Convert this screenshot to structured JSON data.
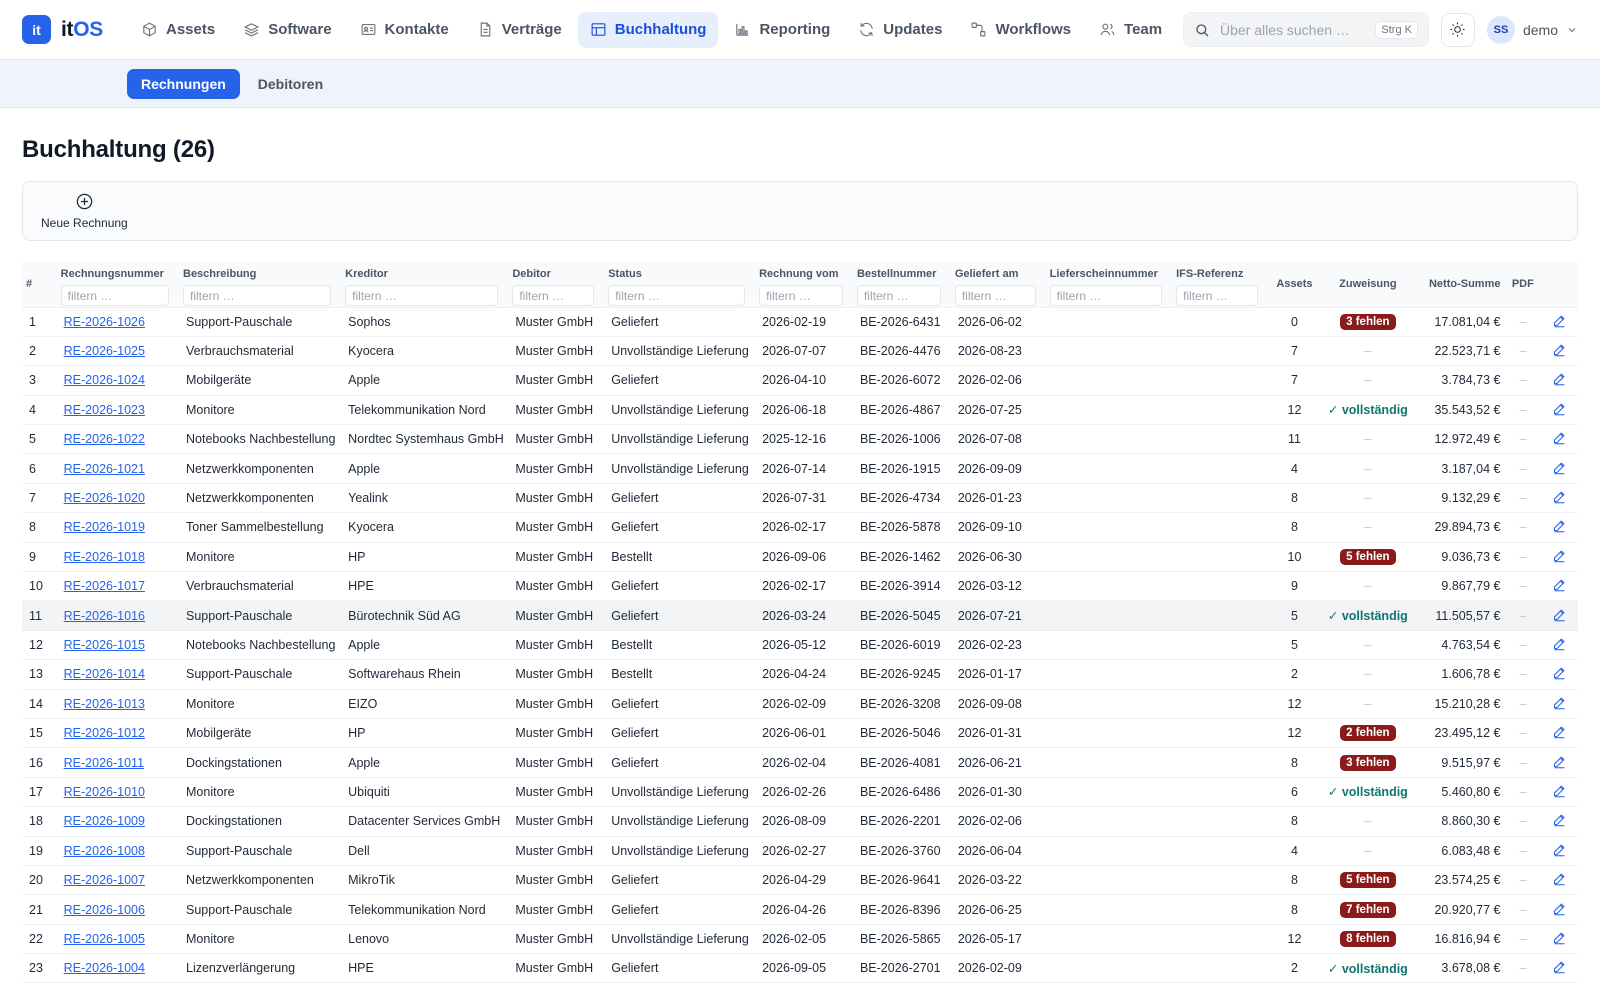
{
  "app": {
    "logo_mark": "it",
    "logo_prefix": "it",
    "logo_suffix": "OS"
  },
  "nav": [
    {
      "label": "Assets",
      "icon": "cube-icon",
      "active": false
    },
    {
      "label": "Software",
      "icon": "layers-icon",
      "active": false
    },
    {
      "label": "Kontakte",
      "icon": "contact-card-icon",
      "active": false
    },
    {
      "label": "Verträge",
      "icon": "document-icon",
      "active": false
    },
    {
      "label": "Buchhaltung",
      "icon": "table-icon",
      "active": true
    },
    {
      "label": "Reporting",
      "icon": "bar-chart-icon",
      "active": false
    },
    {
      "label": "Updates",
      "icon": "refresh-icon",
      "active": false
    },
    {
      "label": "Workflows",
      "icon": "workflow-icon",
      "active": false
    },
    {
      "label": "Team",
      "icon": "users-icon",
      "active": false
    }
  ],
  "search": {
    "placeholder": "Über alles suchen …",
    "shortcut": "Strg K"
  },
  "user": {
    "initials": "SS",
    "name": "demo"
  },
  "subtabs": [
    {
      "label": "Rechnungen",
      "active": true
    },
    {
      "label": "Debitoren",
      "active": false
    }
  ],
  "page": {
    "title": "Buchhaltung (26)"
  },
  "toolbar": {
    "new_invoice": "Neue Rechnung"
  },
  "filter_placeholder": "filtern …",
  "columns": {
    "num": "#",
    "invoice": "Rechnungsnummer",
    "desc": "Beschreibung",
    "creditor": "Kreditor",
    "debtor": "Debitor",
    "status": "Status",
    "invoice_date": "Rechnung vom",
    "order_no": "Bestellnummer",
    "delivered": "Geliefert am",
    "delivery_note": "Lieferscheinnummer",
    "ifs": "IFS-Referenz",
    "assets": "Assets",
    "assignment": "Zuweisung",
    "net": "Netto-Summe",
    "pdf": "PDF"
  },
  "rows": [
    {
      "n": "1",
      "invoice": "RE-2026-1026",
      "desc": "Support-Pauschale",
      "creditor": "Sophos",
      "debtor": "Muster GmbH",
      "status": "Geliefert",
      "date": "2026-02-19",
      "order": "BE-2026-6431",
      "delivered": "2026-06-02",
      "assets": "0",
      "assignment": "3 fehlen",
      "assign_type": "error",
      "net": "17.081,04 €",
      "pdf": "–"
    },
    {
      "n": "2",
      "invoice": "RE-2026-1025",
      "desc": "Verbrauchsmaterial",
      "creditor": "Kyocera",
      "debtor": "Muster GmbH",
      "status": "Unvollständige Lieferung",
      "date": "2026-07-07",
      "order": "BE-2026-4476",
      "delivered": "2026-08-23",
      "assets": "7",
      "assignment": "–",
      "assign_type": "none",
      "net": "22.523,71 €",
      "pdf": "–"
    },
    {
      "n": "3",
      "invoice": "RE-2026-1024",
      "desc": "Mobilgeräte",
      "creditor": "Apple",
      "debtor": "Muster GmbH",
      "status": "Geliefert",
      "date": "2026-04-10",
      "order": "BE-2026-6072",
      "delivered": "2026-02-06",
      "assets": "7",
      "assignment": "–",
      "assign_type": "none",
      "net": "3.784,73 €",
      "pdf": "–"
    },
    {
      "n": "4",
      "invoice": "RE-2026-1023",
      "desc": "Monitore",
      "creditor": "Telekommunikation Nord",
      "debtor": "Muster GmbH",
      "status": "Unvollständige Lieferung",
      "date": "2026-06-18",
      "order": "BE-2026-4867",
      "delivered": "2026-07-25",
      "assets": "12",
      "assignment": "✓ vollständig",
      "assign_type": "ok",
      "net": "35.543,52 €",
      "pdf": "–"
    },
    {
      "n": "5",
      "invoice": "RE-2026-1022",
      "desc": "Notebooks Nachbestellung",
      "creditor": "Nordtec Systemhaus GmbH",
      "debtor": "Muster GmbH",
      "status": "Unvollständige Lieferung",
      "date": "2025-12-16",
      "order": "BE-2026-1006",
      "delivered": "2026-07-08",
      "assets": "11",
      "assignment": "–",
      "assign_type": "none",
      "net": "12.972,49 €",
      "pdf": "–"
    },
    {
      "n": "6",
      "invoice": "RE-2026-1021",
      "desc": "Netzwerkkomponenten",
      "creditor": "Apple",
      "debtor": "Muster GmbH",
      "status": "Unvollständige Lieferung",
      "date": "2026-07-14",
      "order": "BE-2026-1915",
      "delivered": "2026-09-09",
      "assets": "4",
      "assignment": "–",
      "assign_type": "none",
      "net": "3.187,04 €",
      "pdf": "–"
    },
    {
      "n": "7",
      "invoice": "RE-2026-1020",
      "desc": "Netzwerkkomponenten",
      "creditor": "Yealink",
      "debtor": "Muster GmbH",
      "status": "Geliefert",
      "date": "2026-07-31",
      "order": "BE-2026-4734",
      "delivered": "2026-01-23",
      "assets": "8",
      "assignment": "–",
      "assign_type": "none",
      "net": "9.132,29 €",
      "pdf": "–"
    },
    {
      "n": "8",
      "invoice": "RE-2026-1019",
      "desc": "Toner Sammelbestellung",
      "creditor": "Kyocera",
      "debtor": "Muster GmbH",
      "status": "Geliefert",
      "date": "2026-02-17",
      "order": "BE-2026-5878",
      "delivered": "2026-09-10",
      "assets": "8",
      "assignment": "–",
      "assign_type": "none",
      "net": "29.894,73 €",
      "pdf": "–"
    },
    {
      "n": "9",
      "invoice": "RE-2026-1018",
      "desc": "Monitore",
      "creditor": "HP",
      "debtor": "Muster GmbH",
      "status": "Bestellt",
      "date": "2026-09-06",
      "order": "BE-2026-1462",
      "delivered": "2026-06-30",
      "assets": "10",
      "assignment": "5 fehlen",
      "assign_type": "error",
      "net": "9.036,73 €",
      "pdf": "–"
    },
    {
      "n": "10",
      "invoice": "RE-2026-1017",
      "desc": "Verbrauchsmaterial",
      "creditor": "HPE",
      "debtor": "Muster GmbH",
      "status": "Geliefert",
      "date": "2026-02-17",
      "order": "BE-2026-3914",
      "delivered": "2026-03-12",
      "assets": "9",
      "assignment": "–",
      "assign_type": "none",
      "net": "9.867,79 €",
      "pdf": "–"
    },
    {
      "n": "11",
      "invoice": "RE-2026-1016",
      "desc": "Support-Pauschale",
      "creditor": "Bürotechnik Süd AG",
      "debtor": "Muster GmbH",
      "status": "Geliefert",
      "date": "2026-03-24",
      "order": "BE-2026-5045",
      "delivered": "2026-07-21",
      "assets": "5",
      "assignment": "✓ vollständig",
      "assign_type": "ok",
      "net": "11.505,57 €",
      "pdf": "–"
    },
    {
      "n": "12",
      "invoice": "RE-2026-1015",
      "desc": "Notebooks Nachbestellung",
      "creditor": "Apple",
      "debtor": "Muster GmbH",
      "status": "Bestellt",
      "date": "2026-05-12",
      "order": "BE-2026-6019",
      "delivered": "2026-02-23",
      "assets": "5",
      "assignment": "–",
      "assign_type": "none",
      "net": "4.763,54 €",
      "pdf": "–"
    },
    {
      "n": "13",
      "invoice": "RE-2026-1014",
      "desc": "Support-Pauschale",
      "creditor": "Softwarehaus Rhein",
      "debtor": "Muster GmbH",
      "status": "Bestellt",
      "date": "2026-04-24",
      "order": "BE-2026-9245",
      "delivered": "2026-01-17",
      "assets": "2",
      "assignment": "–",
      "assign_type": "none",
      "net": "1.606,78 €",
      "pdf": "–"
    },
    {
      "n": "14",
      "invoice": "RE-2026-1013",
      "desc": "Monitore",
      "creditor": "EIZO",
      "debtor": "Muster GmbH",
      "status": "Geliefert",
      "date": "2026-02-09",
      "order": "BE-2026-3208",
      "delivered": "2026-09-08",
      "assets": "12",
      "assignment": "–",
      "assign_type": "none",
      "net": "15.210,28 €",
      "pdf": "–"
    },
    {
      "n": "15",
      "invoice": "RE-2026-1012",
      "desc": "Mobilgeräte",
      "creditor": "HP",
      "debtor": "Muster GmbH",
      "status": "Geliefert",
      "date": "2026-06-01",
      "order": "BE-2026-5046",
      "delivered": "2026-01-31",
      "assets": "12",
      "assignment": "2 fehlen",
      "assign_type": "error",
      "net": "23.495,12 €",
      "pdf": "–"
    },
    {
      "n": "16",
      "invoice": "RE-2026-1011",
      "desc": "Dockingstationen",
      "creditor": "Apple",
      "debtor": "Muster GmbH",
      "status": "Geliefert",
      "date": "2026-02-04",
      "order": "BE-2026-4081",
      "delivered": "2026-06-21",
      "assets": "8",
      "assignment": "3 fehlen",
      "assign_type": "error",
      "net": "9.515,97 €",
      "pdf": "–"
    },
    {
      "n": "17",
      "invoice": "RE-2026-1010",
      "desc": "Monitore",
      "creditor": "Ubiquiti",
      "debtor": "Muster GmbH",
      "status": "Unvollständige Lieferung",
      "date": "2026-02-26",
      "order": "BE-2026-6486",
      "delivered": "2026-01-30",
      "assets": "6",
      "assignment": "✓ vollständig",
      "assign_type": "ok",
      "net": "5.460,80 €",
      "pdf": "–"
    },
    {
      "n": "18",
      "invoice": "RE-2026-1009",
      "desc": "Dockingstationen",
      "creditor": "Datacenter Services GmbH",
      "debtor": "Muster GmbH",
      "status": "Unvollständige Lieferung",
      "date": "2026-08-09",
      "order": "BE-2026-2201",
      "delivered": "2026-02-06",
      "assets": "8",
      "assignment": "–",
      "assign_type": "none",
      "net": "8.860,30 €",
      "pdf": "–"
    },
    {
      "n": "19",
      "invoice": "RE-2026-1008",
      "desc": "Support-Pauschale",
      "creditor": "Dell",
      "debtor": "Muster GmbH",
      "status": "Unvollständige Lieferung",
      "date": "2026-02-27",
      "order": "BE-2026-3760",
      "delivered": "2026-06-04",
      "assets": "4",
      "assignment": "–",
      "assign_type": "none",
      "net": "6.083,48 €",
      "pdf": "–"
    },
    {
      "n": "20",
      "invoice": "RE-2026-1007",
      "desc": "Netzwerkkomponenten",
      "creditor": "MikroTik",
      "debtor": "Muster GmbH",
      "status": "Geliefert",
      "date": "2026-04-29",
      "order": "BE-2026-9641",
      "delivered": "2026-03-22",
      "assets": "8",
      "assignment": "5 fehlen",
      "assign_type": "error",
      "net": "23.574,25 €",
      "pdf": "–"
    },
    {
      "n": "21",
      "invoice": "RE-2026-1006",
      "desc": "Support-Pauschale",
      "creditor": "Telekommunikation Nord",
      "debtor": "Muster GmbH",
      "status": "Geliefert",
      "date": "2026-04-26",
      "order": "BE-2026-8396",
      "delivered": "2026-06-25",
      "assets": "8",
      "assignment": "7 fehlen",
      "assign_type": "error",
      "net": "20.920,77 €",
      "pdf": "–"
    },
    {
      "n": "22",
      "invoice": "RE-2026-1005",
      "desc": "Monitore",
      "creditor": "Lenovo",
      "debtor": "Muster GmbH",
      "status": "Unvollständige Lieferung",
      "date": "2026-02-05",
      "order": "BE-2026-5865",
      "delivered": "2026-05-17",
      "assets": "12",
      "assignment": "8 fehlen",
      "assign_type": "error",
      "net": "16.816,94 €",
      "pdf": "–"
    },
    {
      "n": "23",
      "invoice": "RE-2026-1004",
      "desc": "Lizenzverlängerung",
      "creditor": "HPE",
      "debtor": "Muster GmbH",
      "status": "Geliefert",
      "date": "2026-09-05",
      "order": "BE-2026-2701",
      "delivered": "2026-02-09",
      "assets": "2",
      "assignment": "✓ vollständig",
      "assign_type": "ok",
      "net": "3.678,08 €",
      "pdf": "–"
    }
  ],
  "highlighted_row": "11",
  "colors": {
    "accent": "#2563eb",
    "error_badge": "#8b1a1a",
    "ok_text": "#0f766e",
    "subbar_bg": "#eef3fc"
  }
}
